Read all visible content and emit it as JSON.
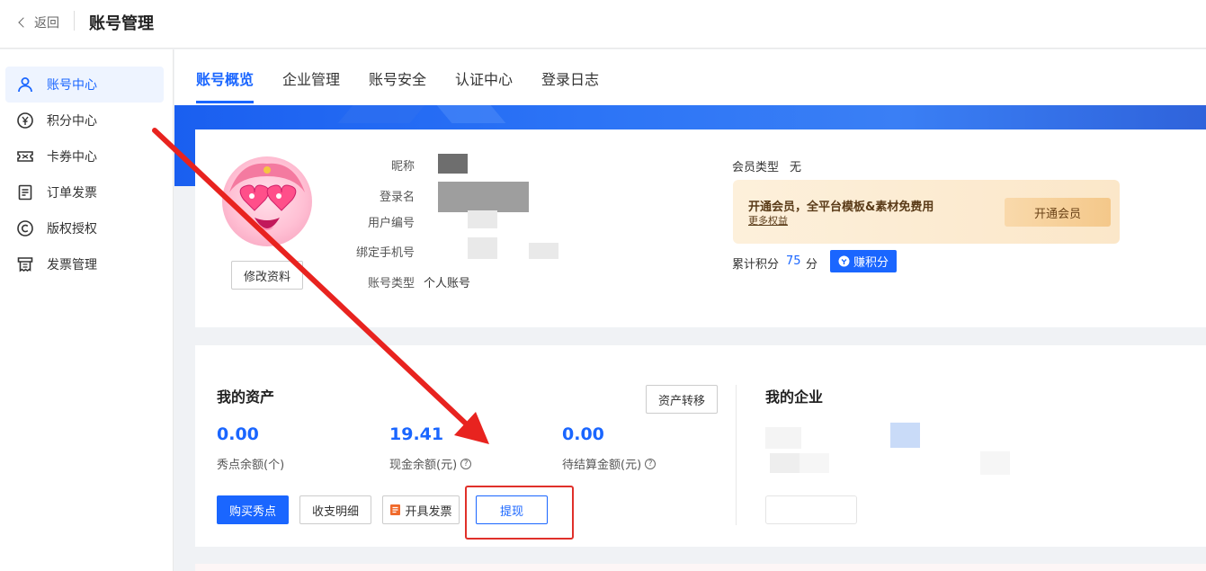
{
  "topbar": {
    "back_label": "返回",
    "title": "账号管理"
  },
  "sidebar": {
    "items": [
      {
        "label": "账号中心",
        "icon": "user-icon",
        "active": true
      },
      {
        "label": "积分中心",
        "icon": "points-icon"
      },
      {
        "label": "卡券中心",
        "icon": "coupon-icon"
      },
      {
        "label": "订单发票",
        "icon": "document-icon"
      },
      {
        "label": "版权授权",
        "icon": "copyright-icon"
      },
      {
        "label": "发票管理",
        "icon": "invoice-icon"
      }
    ]
  },
  "tabs": [
    "账号概览",
    "企业管理",
    "账号安全",
    "认证中心",
    "登录日志"
  ],
  "profile": {
    "edit_button": "修改资料",
    "fields": {
      "nickname_label": "昵称",
      "login_label": "登录名",
      "user_id_label": "用户编号",
      "phone_label": "绑定手机号",
      "account_type_label": "账号类型",
      "account_type_value": "个人账号"
    },
    "membership": {
      "type_label": "会员类型",
      "type_value": "无",
      "promo_title": "开通会员，全平台模板&素材免费用",
      "promo_link": "更多权益",
      "promo_button": "开通会员",
      "points_label": "累计积分",
      "points_value": "75",
      "points_unit": "分",
      "earn_button": "赚积分"
    }
  },
  "assets": {
    "title": "我的资产",
    "transfer_button": "资产转移",
    "items": [
      {
        "value": "0.00",
        "label": "秀点余额(个)"
      },
      {
        "value": "19.41",
        "label": "现金余额(元)"
      },
      {
        "value": "0.00",
        "label": "待结算金额(元)"
      }
    ],
    "buttons": {
      "buy": "购买秀点",
      "detail": "收支明细",
      "invoice": "开具发票",
      "withdraw": "提现"
    }
  },
  "enterprise": {
    "title": "我的企业"
  },
  "colors": {
    "accent": "#1a66ff",
    "annotation": "#e0302a"
  }
}
